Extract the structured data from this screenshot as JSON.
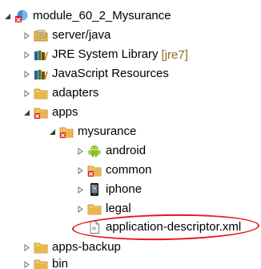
{
  "tree": {
    "items": [
      {
        "label": "module_60_2_Mysurance",
        "decoration": "",
        "icon": "project-icon",
        "expanded": true
      },
      {
        "label": "server/java",
        "decoration": "",
        "icon": "java-source-folder-icon",
        "expanded": false
      },
      {
        "label": "JRE System Library",
        "decoration": "[jre7]",
        "icon": "library-icon",
        "expanded": false
      },
      {
        "label": "JavaScript Resources",
        "decoration": "",
        "icon": "library-icon",
        "expanded": false
      },
      {
        "label": "adapters",
        "decoration": "",
        "icon": "folder-icon",
        "expanded": false
      },
      {
        "label": "apps",
        "decoration": "",
        "icon": "worklight-folder-icon",
        "expanded": true
      },
      {
        "label": "mysurance",
        "decoration": "",
        "icon": "worklight-folder-icon",
        "expanded": true
      },
      {
        "label": "android",
        "decoration": "",
        "icon": "android-icon",
        "expanded": false
      },
      {
        "label": "common",
        "decoration": "",
        "icon": "worklight-folder-icon",
        "expanded": false
      },
      {
        "label": "iphone",
        "decoration": "",
        "icon": "iphone-icon",
        "expanded": false
      },
      {
        "label": "legal",
        "decoration": "",
        "icon": "folder-icon",
        "expanded": false
      },
      {
        "label": "application-descriptor.xml",
        "decoration": "",
        "icon": "xml-file-icon",
        "expanded": null
      },
      {
        "label": "apps-backup",
        "decoration": "",
        "icon": "folder-icon",
        "expanded": false
      },
      {
        "label": "bin",
        "decoration": "",
        "icon": "folder-icon",
        "expanded": false
      }
    ]
  },
  "colors": {
    "folder": "#e8b64a",
    "highlight": "#e8151b",
    "decoration": "#8a6d1d"
  }
}
